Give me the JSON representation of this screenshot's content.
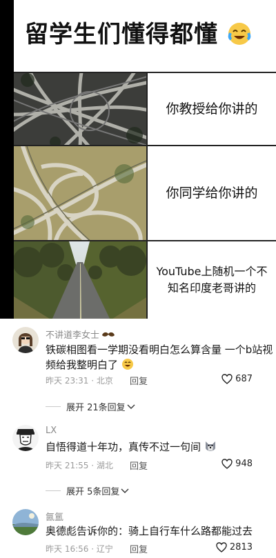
{
  "meme": {
    "title": "留学生们懂得都懂",
    "title_emoji": "laughing-crying-face-icon",
    "rows": [
      {
        "caption": "你教授给你讲的",
        "image": "tangled-highway-interchange"
      },
      {
        "caption": "你同学给你讲的",
        "image": "cloverleaf-interchange"
      },
      {
        "caption": "YouTube上随机一个不知名印度老哥讲的",
        "image": "straight-country-road"
      }
    ]
  },
  "comments": [
    {
      "username": "不讲道李女士",
      "username_badge": "mustache-icon",
      "text": "铁碳相图看一学期没看明白怎么算含量 一个b站视频给我整明白了",
      "text_emoji": "grinning-face-icon",
      "time": "昨天 23:31 · 北京",
      "reply_label": "回复",
      "likes": "687",
      "expand_label": "展开 21条回复"
    },
    {
      "username": "LX",
      "text": "自悟得道十年功，真传不过一句间",
      "text_emoji": "dog-face-icon",
      "time": "昨天 21:55 · 湖北",
      "reply_label": "回复",
      "likes": "948",
      "expand_label": "展开 5条回复"
    },
    {
      "username": "氤氲",
      "text": "奥德彪告诉你的：骑上自行车什么路都能过去",
      "time": "昨天 16:56 · 辽宁",
      "reply_label": "回复",
      "likes": "2813"
    }
  ],
  "colors": {
    "background": "#000000",
    "panel": "#ffffff",
    "muted_text": "#8a8a8a"
  }
}
